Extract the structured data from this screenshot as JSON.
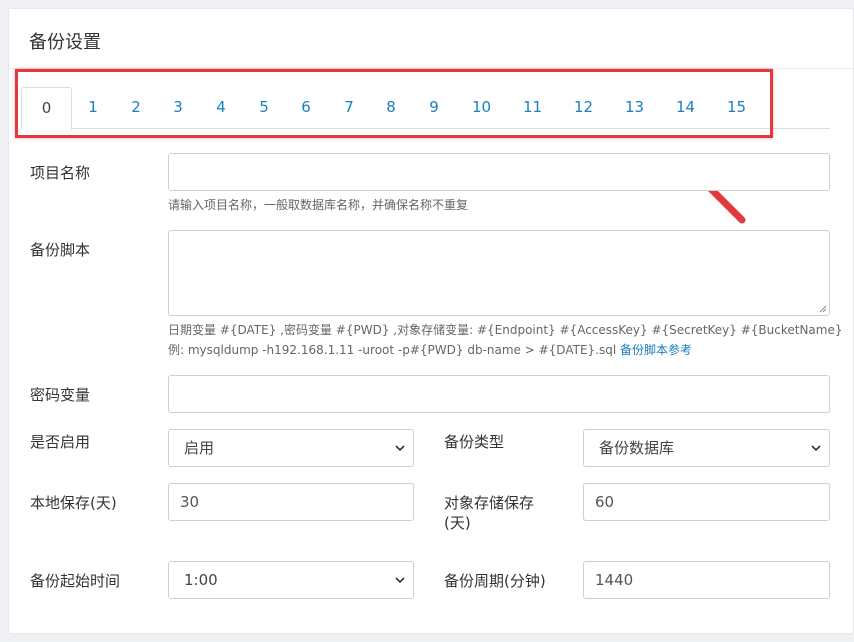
{
  "header": {
    "title": "备份设置"
  },
  "tabs": [
    "0",
    "1",
    "2",
    "3",
    "4",
    "5",
    "6",
    "7",
    "8",
    "9",
    "10",
    "11",
    "12",
    "13",
    "14",
    "15"
  ],
  "form": {
    "project_name": {
      "label": "项目名称",
      "value": "",
      "help": "请输入项目名称，一般取数据库名称，并确保名称不重复"
    },
    "backup_script": {
      "label": "备份脚本",
      "value": "",
      "help_line1": "日期变量 #{DATE} ,密码变量 #{PWD} ,对象存储变量: #{Endpoint} #{AccessKey} #{SecretKey} #{BucketName}",
      "help_line2": "例: mysqldump -h192.168.1.11 -uroot -p#{PWD} db-name > #{DATE}.sql",
      "help_link": "备份脚本参考"
    },
    "password_var": {
      "label": "密码变量",
      "value": ""
    },
    "enabled": {
      "label": "是否启用",
      "value": "启用"
    },
    "backup_type": {
      "label": "备份类型",
      "value": "备份数据库"
    },
    "local_keep": {
      "label": "本地保存(天)",
      "value": "30"
    },
    "object_keep": {
      "label_line1": "对象存储保存",
      "label_line2": "(天)",
      "value": "60"
    },
    "start_time": {
      "label": "备份起始时间",
      "value": "1:00"
    },
    "period": {
      "label": "备份周期(分钟)",
      "value": "1440"
    }
  },
  "colors": {
    "accent": "#1a7fc1",
    "highlight": "#e2393f"
  },
  "annotation": {
    "highlight": "red-rectangle",
    "arrow": "red-arrow"
  }
}
